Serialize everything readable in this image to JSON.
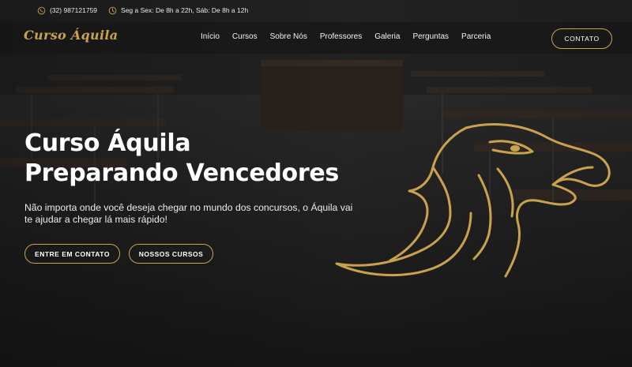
{
  "topbar": {
    "phone_icon": "whatsapp-icon",
    "phone": "(32) 987121759",
    "hours_icon": "clock-icon",
    "hours": "Seg a Sex: De 8h a 22h, Sáb: De 8h a 12h"
  },
  "navbar": {
    "logo": "Curso Áquila",
    "links": [
      "Início",
      "Cursos",
      "Sobre Nós",
      "Professores",
      "Galeria",
      "Perguntas",
      "Parceria"
    ],
    "cta": "CONTATO"
  },
  "hero": {
    "title_line1": "Curso Áquila",
    "title_line2": "Preparando Vencedores",
    "subtitle": "Não importa onde você deseja chegar no mundo dos concursos, o Áquila vai te ajudar a chegar lá mais rápido!",
    "button_primary": "ENTRE EM CONTATO",
    "button_secondary": "NOSSOS CURSOS"
  },
  "colors": {
    "accent": "#c9a24d",
    "text": "#ffffff",
    "background": "#1f1f1f"
  }
}
